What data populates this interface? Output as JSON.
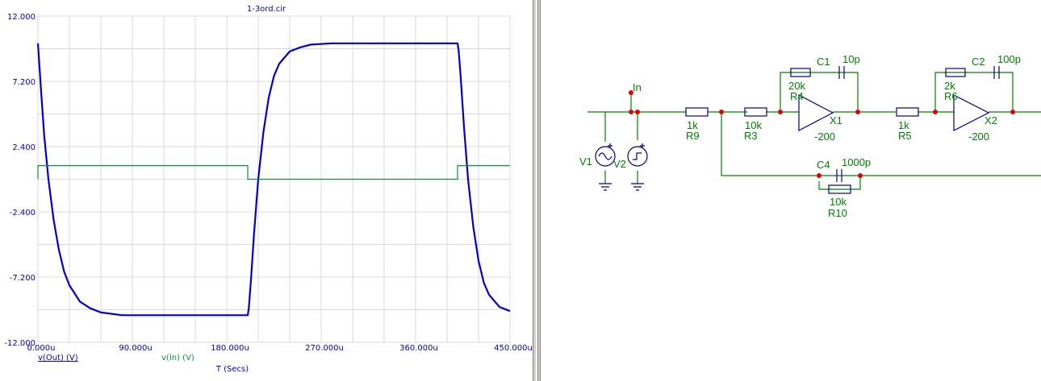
{
  "plot": {
    "title": "1-3ord.cir",
    "x_label": "T (Secs)",
    "legend": [
      {
        "label": "v(Out) (V)",
        "color": "#0000cc"
      },
      {
        "label": "v(In) (V)",
        "color": "#009933"
      }
    ]
  },
  "chart_data": {
    "type": "line",
    "title": "1-3ord.cir",
    "xlabel": "T (Secs)",
    "ylabel": "",
    "xlim": [
      0,
      450
    ],
    "ylim": [
      -12,
      12
    ],
    "x_ticks": [
      {
        "v": 0,
        "label": "0.000u"
      },
      {
        "v": 90,
        "label": "90.000u"
      },
      {
        "v": 180,
        "label": "180.000u"
      },
      {
        "v": 270,
        "label": "270.000u"
      },
      {
        "v": 360,
        "label": "360.000u"
      },
      {
        "v": 450,
        "label": "450.000u"
      }
    ],
    "y_ticks": [
      {
        "v": 12,
        "label": "12.000"
      },
      {
        "v": 7.2,
        "label": "7.200"
      },
      {
        "v": 2.4,
        "label": "2.400"
      },
      {
        "v": -2.4,
        "label": "-2.400"
      },
      {
        "v": -7.2,
        "label": "-7.200"
      },
      {
        "v": -12,
        "label": "-12.000"
      }
    ],
    "grid": true,
    "series": [
      {
        "name": "v(Out) (V)",
        "color": "#0000cc",
        "x": [
          0,
          3,
          6,
          10,
          15,
          20,
          25,
          30,
          40,
          50,
          60,
          80,
          100,
          130,
          160,
          200,
          201,
          203,
          206,
          210,
          215,
          220,
          225,
          230,
          240,
          250,
          260,
          280,
          300,
          330,
          360,
          400,
          401,
          403,
          406,
          410,
          415,
          420,
          425,
          430,
          440,
          450
        ],
        "y": [
          10.0,
          6.5,
          3.2,
          0.0,
          -3.0,
          -5.2,
          -6.8,
          -7.8,
          -9.0,
          -9.5,
          -9.8,
          -10.0,
          -10.0,
          -10.0,
          -10.0,
          -10.0,
          -9.5,
          -7.5,
          -4.0,
          0.0,
          3.5,
          6.0,
          7.6,
          8.5,
          9.4,
          9.7,
          9.9,
          10.0,
          10.0,
          10.0,
          10.0,
          10.0,
          9.5,
          7.5,
          4.0,
          0.0,
          -3.5,
          -6.0,
          -7.6,
          -8.5,
          -9.4,
          -9.7
        ]
      },
      {
        "name": "v(In) (V)",
        "color": "#009933",
        "x": [
          0,
          0,
          200,
          200,
          400,
          400,
          450
        ],
        "y": [
          0,
          1.0,
          1.0,
          0,
          0,
          1.0,
          1.0
        ]
      }
    ]
  },
  "schematic": {
    "labels": {
      "in": "In",
      "v1": "V1",
      "v2": "V2",
      "r9": "R9",
      "r9v": "1k",
      "r3": "R3",
      "r3v": "10k",
      "r4": "R4",
      "r4v": "20k",
      "c1": "C1",
      "c1v": "10p",
      "x1": "X1",
      "x1g": "-200",
      "r5": "R5",
      "r5v": "1k",
      "r6": "R6",
      "r6v": "2k",
      "c2": "C2",
      "c2v": "100p",
      "x2": "X2",
      "x2g": "-200",
      "c4": "C4",
      "c4v": "1000p",
      "r10": "R10",
      "r10v": "10k"
    },
    "colors": {
      "wire": "#008000",
      "part": "#000080",
      "node": "#e00000",
      "label": "#008000"
    }
  }
}
